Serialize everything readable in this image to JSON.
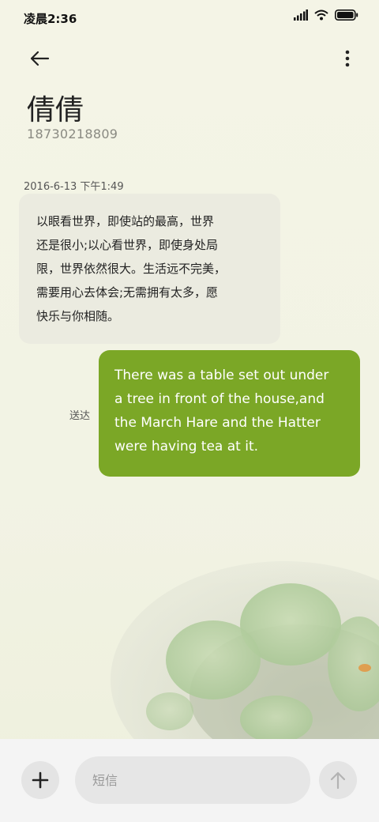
{
  "status_bar": {
    "time": "凌晨2:36"
  },
  "contact": {
    "name": "倩倩",
    "number": "18730218809"
  },
  "conversation": {
    "timestamp": "2016-6-13 下午1:49",
    "incoming": {
      "lines": [
        "以眼看世界，即使站的最高，世界",
        "还是很小;以心看世界，即使身处局",
        "限，世界依然很大。生活远不完美，",
        "需要用心去体会;无需拥有太多，愿",
        "快乐与你相随。"
      ]
    },
    "outgoing": {
      "lines": [
        "There was a table set out under",
        "a tree in front of the house,and",
        "the March Hare and the Hatter",
        "were having tea at it."
      ],
      "status": "送达"
    }
  },
  "composer": {
    "placeholder": "短信"
  },
  "icons": {
    "back": "arrow-left-icon",
    "more": "more-vertical-icon",
    "add": "plus-icon",
    "send": "arrow-up-icon",
    "signal": "signal-icon",
    "wifi": "wifi-icon",
    "battery": "battery-icon"
  },
  "colors": {
    "outgoing_bubble": "#7ba726",
    "incoming_bubble": "#ebebe0",
    "background": "#f4f4e6"
  }
}
